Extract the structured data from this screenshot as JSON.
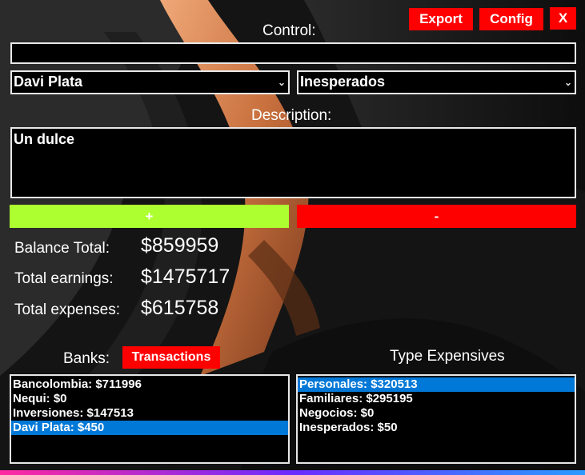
{
  "header": {
    "export_label": "Export",
    "config_label": "Config",
    "close_label": "X"
  },
  "control": {
    "label": "Control:",
    "value": ""
  },
  "bank_select": {
    "value": "Davi Plata"
  },
  "category_select": {
    "value": "Inesperados"
  },
  "description": {
    "label": "Description:",
    "value": "Un dulce"
  },
  "actions": {
    "plus_label": "+",
    "minus_label": "-"
  },
  "stats": [
    {
      "label": "Balance Total:",
      "value": "$859959"
    },
    {
      "label": "Total earnings:",
      "value": "$1475717"
    },
    {
      "label": "Total expenses:",
      "value": "$615758"
    }
  ],
  "banks": {
    "label": "Banks:",
    "transactions_label": "Transactions",
    "items": [
      "Bancolombia: $711996",
      "Nequi: $0",
      "Inversiones: $147513",
      "Davi Plata: $450"
    ],
    "selected_index": 3
  },
  "expenses": {
    "label": "Type Expensives",
    "items": [
      "Personales: $320513",
      "Familiares: $295195",
      "Negocios: $0",
      "Inesperados: $50"
    ],
    "selected_index": 0
  },
  "colors": {
    "accent_red": "#ff0000",
    "accent_green": "#adff2f",
    "selection_blue": "#0078d7"
  }
}
